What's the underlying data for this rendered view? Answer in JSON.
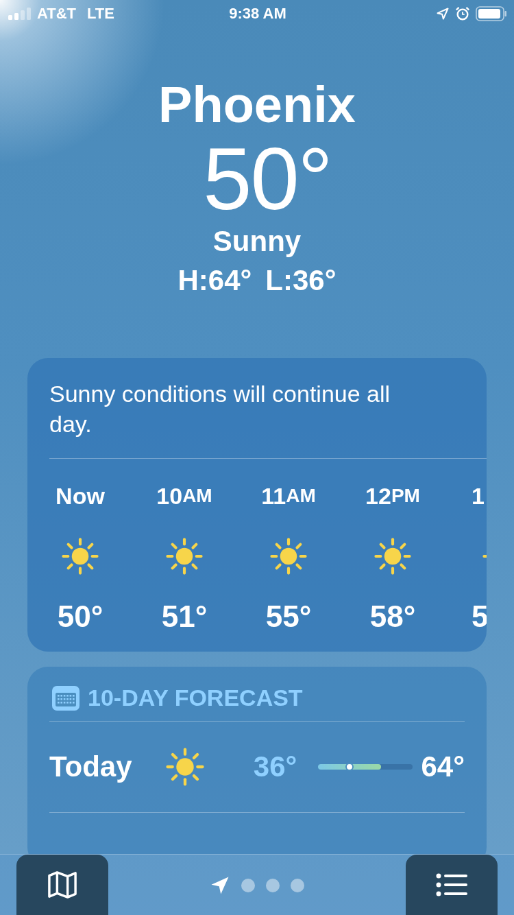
{
  "status_bar": {
    "carrier": "AT&T",
    "network": "LTE",
    "time": "9:38 AM"
  },
  "location": {
    "city": "Phoenix",
    "temperature": "50°",
    "condition": "Sunny",
    "high": "H:64°",
    "low": "L:36°"
  },
  "hourly": {
    "summary": "Sunny conditions will continue all day.",
    "hours": [
      {
        "time": "Now",
        "temperature": "50°"
      },
      {
        "time": "10",
        "time_suffix": "AM",
        "temperature": "51°"
      },
      {
        "time": "11",
        "time_suffix": "AM",
        "temperature": "55°"
      },
      {
        "time": "12",
        "time_suffix": "PM",
        "temperature": "58°"
      },
      {
        "time": "1",
        "temperature": "5"
      }
    ]
  },
  "forecast": {
    "title": "10-DAY FORECAST",
    "days": [
      {
        "day": "Today",
        "low": "36°",
        "high": "64°",
        "range": {
          "level": 0.66
        },
        "current_marker": {
          "level": 0.33
        }
      }
    ]
  },
  "pages": [
    {
      "kind": "location",
      "selected": true
    },
    {
      "kind": "dot",
      "selected": false
    },
    {
      "kind": "dot",
      "selected": false
    },
    {
      "kind": "dot",
      "selected": false
    }
  ]
}
